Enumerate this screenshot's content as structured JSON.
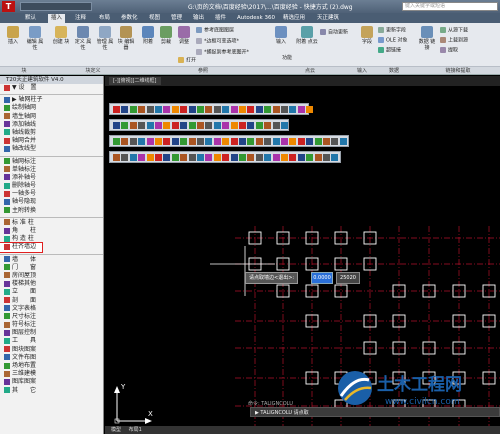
{
  "titlebar": {
    "logo": "T",
    "title": "G:\\页的文档\\百度经验\\2017\\...\\百度经验 - 快捷方式 (2).dwg",
    "search_placeholder": "键入关键字或短语"
  },
  "tabs": [
    "默认",
    "插入",
    "注释",
    "布局",
    "参数化",
    "视图",
    "管理",
    "输出",
    "插件",
    "Autodesk 360",
    "精选应用",
    "天正建筑"
  ],
  "active_tab": "插入",
  "ribbon": {
    "insert_label": "插入",
    "edit_label": "编辑\n属性",
    "create_block_label": "创建\n块",
    "define_attr_label": "定义\n属性",
    "manage_attr_label": "管理\n属性",
    "block_editor_label": "块\n编辑器",
    "attach_label": "附着",
    "clip_label": "剪裁",
    "adjust_label": "调整",
    "underlay_layers": "参考底图图层",
    "edge_frame": "*边框可变选项*",
    "snap_underlay": "*捕捉到参考底图开*",
    "open_label": "打开",
    "function_label": "功能",
    "import_label": "输入",
    "attach_cloud": "附着\n点云",
    "auto_update": "自动更新",
    "field_label": "字段",
    "update_field": "更新字段",
    "ole_object": "OLE 对象",
    "hyperlink": "超链接",
    "data_link_label": "数据\n链接",
    "from_source": "从源下载",
    "upload_source": "上载到源",
    "extract_label": "提取",
    "group_block": "块",
    "group_block_def": "块定义",
    "group_reference": "参照",
    "group_pointcloud": "点云",
    "group_input": "输入",
    "group_data": "数据",
    "group_link": "链接和提取"
  },
  "file_tab": "[-][俯视][二维线框]",
  "panel": {
    "header": "T20天正建筑软件 V4.0",
    "items": [
      "▼ 设　置",
      "▶ 轴网柱子",
      "绘制轴网",
      "墙生轴网",
      "添加轴线",
      "轴线裁剪",
      "轴网合并",
      "轴改线型",
      "轴网标注",
      "单轴标注",
      "添补轴号",
      "删除轴号",
      "一轴多号",
      "轴号隐现",
      "主附转换",
      "标 准 柱",
      "角　　柱",
      "构 造 柱",
      "柱齐墙边",
      "墙　　体",
      "门　　窗",
      "房间屋顶",
      "楼梯其他",
      "立　　面",
      "剖　　面",
      "文字表格",
      "尺寸标注",
      "符号标注",
      "图层控制",
      "工　　具",
      "图块图案",
      "文件布图",
      "场地布置",
      "三维建模",
      "图库图案",
      "其　　它"
    ],
    "highlighted": "柱齐墙边"
  },
  "prompt": {
    "text": "请点取墙边<退出>:",
    "value1": "0.0000",
    "value2": "25020"
  },
  "command": {
    "history": "命令: TALIGNCOLU",
    "line": "▶ TALIGNCOLU 请点取"
  },
  "axis": {
    "x": "X",
    "y": "Y"
  },
  "status": {
    "model": "模型",
    "layout1": "布局1"
  },
  "watermark": {
    "text": "土木工程网",
    "url": "www.civilcn.com",
    "color": "#1a5fa8"
  }
}
